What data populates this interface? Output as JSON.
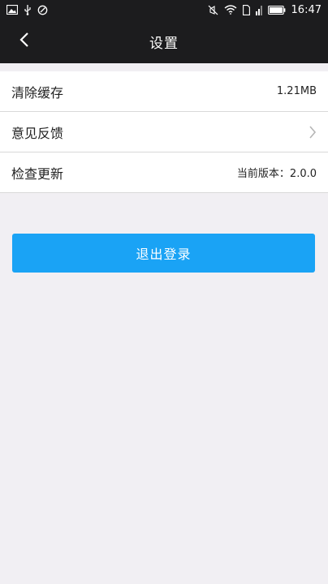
{
  "status_bar": {
    "time": "16:47",
    "left_icons": [
      "image-icon",
      "usb-icon",
      "sync-icon"
    ],
    "right_icons": [
      "mute-icon",
      "wifi-icon",
      "sim-icon",
      "signal-icon",
      "battery-icon"
    ]
  },
  "header": {
    "title": "设置",
    "back_icon": "chevron-left-icon"
  },
  "settings": {
    "items": [
      {
        "label": "清除缓存",
        "value": "1.21MB"
      },
      {
        "label": "意见反馈",
        "value": ""
      },
      {
        "label": "检查更新",
        "value": "当前版本：2.0.0"
      }
    ]
  },
  "logout": {
    "label": "退出登录"
  },
  "colors": {
    "header_bg": "#1c1c1e",
    "page_bg": "#f1eff3",
    "accent": "#1aa3f5"
  }
}
